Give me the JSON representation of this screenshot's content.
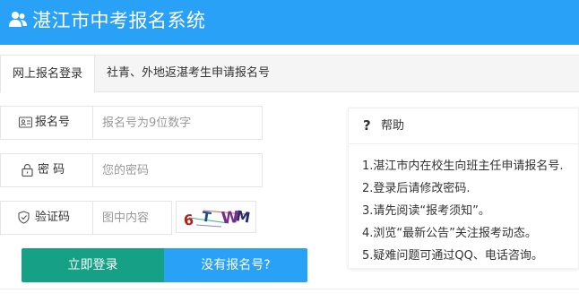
{
  "header": {
    "title": "湛江市中考报名系统",
    "logo_icon": "users-icon"
  },
  "tabs": [
    {
      "label": "网上报名登录",
      "active": true
    },
    {
      "label": "社青、外地返湛考生申请报名号",
      "active": false
    }
  ],
  "form": {
    "regno": {
      "label": "报名号",
      "placeholder": "报名号为9位数字",
      "icon": "id-card-icon"
    },
    "password": {
      "label": "密 码",
      "placeholder": "您的密码",
      "icon": "lock-icon"
    },
    "captcha": {
      "label": "验证码",
      "placeholder": "图中内容",
      "icon": "shield-icon",
      "image_text": "6TWM"
    },
    "login_label": "立即登录",
    "noreg_label": "没有报名号?"
  },
  "help": {
    "icon": "question-icon",
    "title": "帮助",
    "items": [
      "1.湛江市内在校生向班主任申请报名号.",
      "2.登录后请修改密码.",
      "3.请先阅读“报考须知”。",
      "4.浏览“最新公告”关注报考动态。",
      "5.疑难问题可通过QQ、电话咨询。"
    ]
  },
  "colors": {
    "header_bg": "#29a1f7",
    "login_btn": "#16a085",
    "noreg_btn": "#29a1f7"
  }
}
